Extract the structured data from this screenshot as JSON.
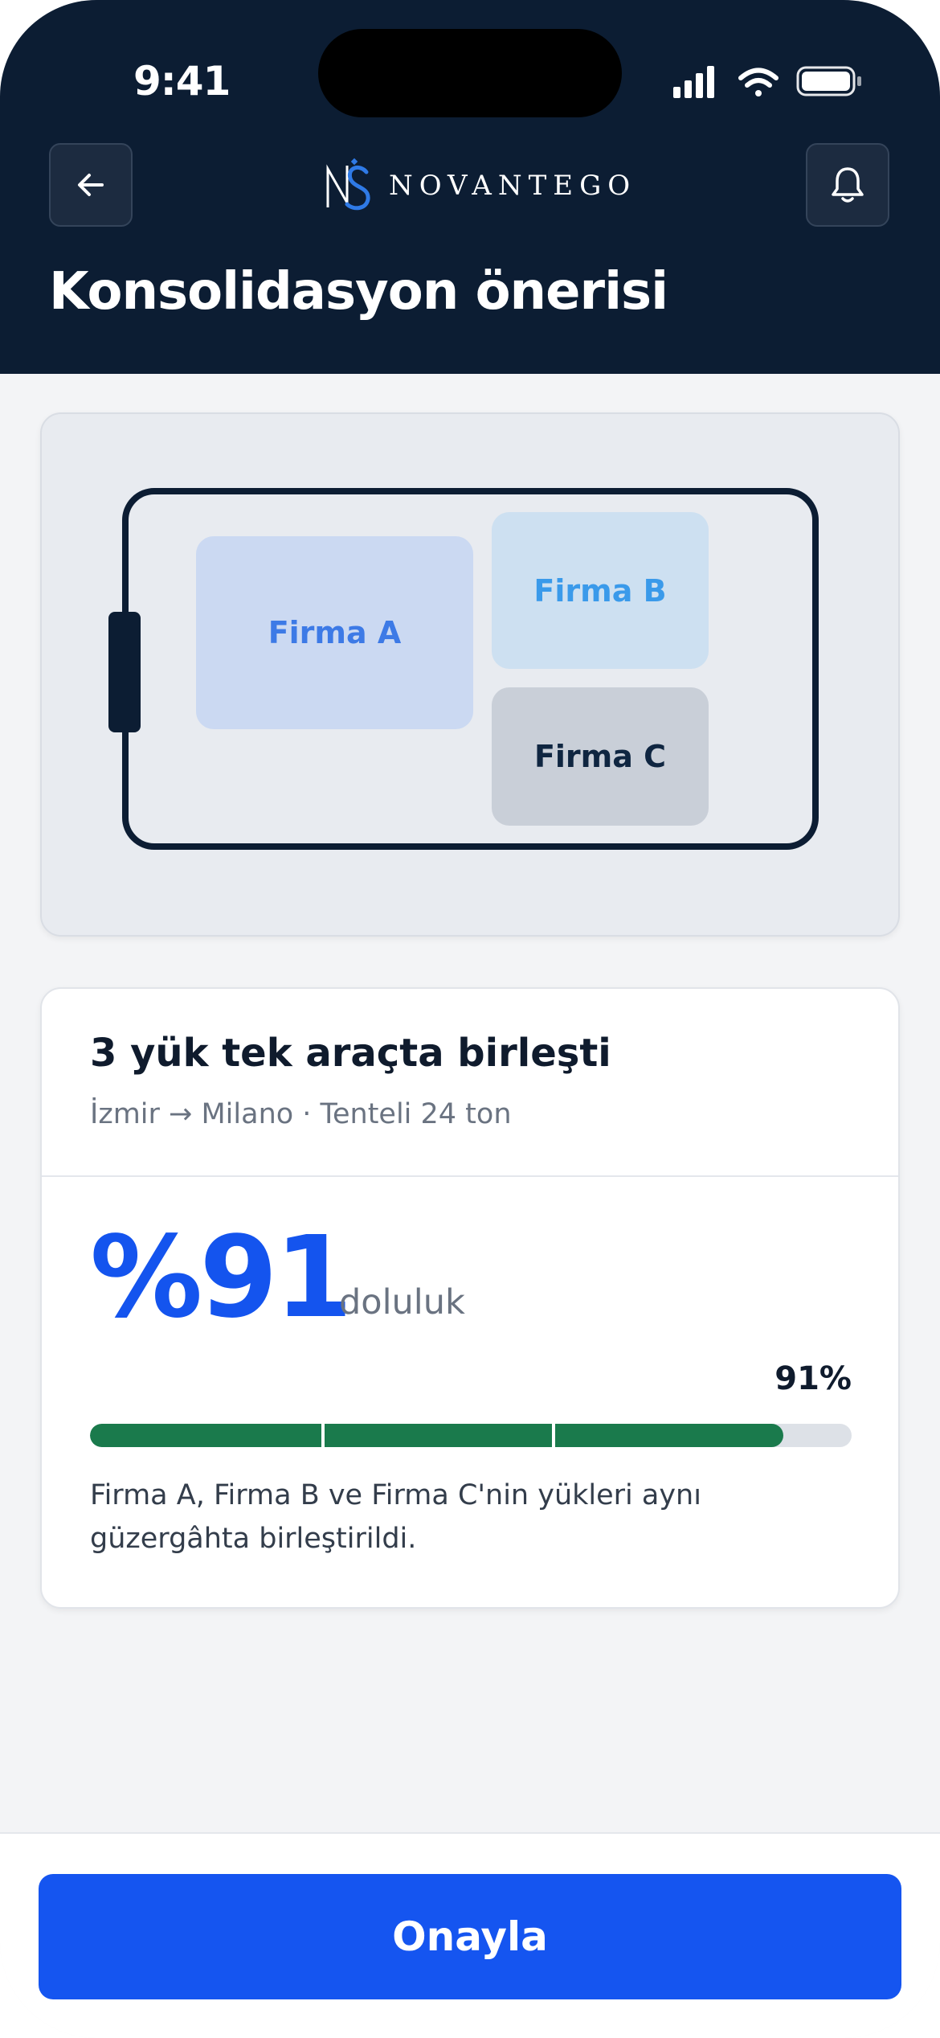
{
  "status_bar": {
    "time": "9:41",
    "signal_icon": "cellular-signal-icon",
    "wifi_icon": "wifi-icon",
    "battery_icon": "battery-icon"
  },
  "header": {
    "back_icon": "arrow-left-icon",
    "logo_mark": "NS",
    "logo_text": "NOVANTEGO",
    "bell_icon": "bell-icon",
    "title": "Konsolidasyon önerisi"
  },
  "illustration": {
    "cargo": [
      {
        "label": "Firma A"
      },
      {
        "label": "Firma B"
      },
      {
        "label": "Firma C"
      }
    ]
  },
  "summary": {
    "title": "3 yük tek araçta birleşti",
    "subtitle": "İzmir → Milano · Tenteli 24 ton",
    "big_percent": "%91",
    "percent_label": "doluluk",
    "progress_text": "91%",
    "progress_value": 0.91,
    "progress_segments": 3,
    "description": "Firma A, Firma B ve Firma C'nin yükleri aynı güzergâhta birleştirildi."
  },
  "footer": {
    "confirm_label": "Onayla"
  },
  "colors": {
    "header_bg": "#0c1d33",
    "accent": "#1454ee",
    "progress": "#1a7a4c",
    "logo_blue": "#2f7ae6"
  }
}
